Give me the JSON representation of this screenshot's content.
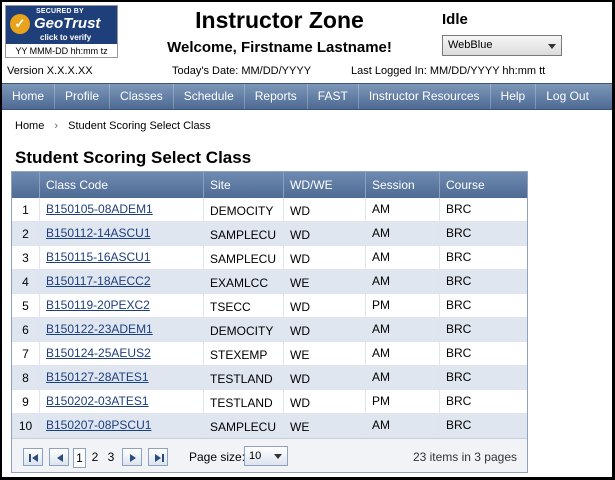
{
  "seal": {
    "secured_by": "SECURED BY",
    "brand": "GeoTrust",
    "click_to_verify": "click to verify",
    "date": "YY MMM-DD hh:mm tz"
  },
  "header": {
    "title": "Instructor Zone",
    "welcome": "Welcome, Firstname Lastname!",
    "status": "Idle",
    "theme_value": "WebBlue",
    "version": "Version X.X.X.XX",
    "todays_date": "Today's Date: MM/DD/YYYY",
    "last_logged_in": "Last Logged In: MM/DD/YYYY hh:mm tt"
  },
  "nav": {
    "items": [
      "Home",
      "Profile",
      "Classes",
      "Schedule",
      "Reports",
      "FAST",
      "Instructor Resources",
      "Help",
      "Log Out"
    ]
  },
  "breadcrumb": {
    "home": "Home",
    "separator": "›",
    "current": "Student Scoring Select Class"
  },
  "page_title": "Student Scoring Select Class",
  "grid": {
    "columns": [
      "",
      "Class Code",
      "Site",
      "WD/WE",
      "Session",
      "Course"
    ],
    "rows": [
      [
        "1",
        "B150105-08ADEM1",
        "DEMOCITY",
        "WD",
        "AM",
        "BRC"
      ],
      [
        "2",
        "B150112-14ASCU1",
        "SAMPLECU",
        "WD",
        "AM",
        "BRC"
      ],
      [
        "3",
        "B150115-16ASCU1",
        "SAMPLECU",
        "WD",
        "AM",
        "BRC"
      ],
      [
        "4",
        "B150117-18AECC2",
        "EXAMLCC",
        "WE",
        "AM",
        "BRC"
      ],
      [
        "5",
        "B150119-20PEXC2",
        "TSECC",
        "WD",
        "PM",
        "BRC"
      ],
      [
        "6",
        "B150122-23ADEM1",
        "DEMOCITY",
        "WD",
        "AM",
        "BRC"
      ],
      [
        "7",
        "B150124-25AEUS2",
        "STEXEMP",
        "WE",
        "AM",
        "BRC"
      ],
      [
        "8",
        "B150127-28ATES1",
        "TESTLAND",
        "WD",
        "AM",
        "BRC"
      ],
      [
        "9",
        "B150202-03ATES1",
        "TESTLAND",
        "WD",
        "PM",
        "BRC"
      ],
      [
        "10",
        "B150207-08PSCU1",
        "SAMPLECU",
        "WE",
        "AM",
        "BRC"
      ]
    ]
  },
  "pager": {
    "pages": [
      "1",
      "2",
      "3"
    ],
    "current_page": "1",
    "page_size_label": "Page size:",
    "page_size_value": "10",
    "info": "23 items in 3 pages"
  }
}
